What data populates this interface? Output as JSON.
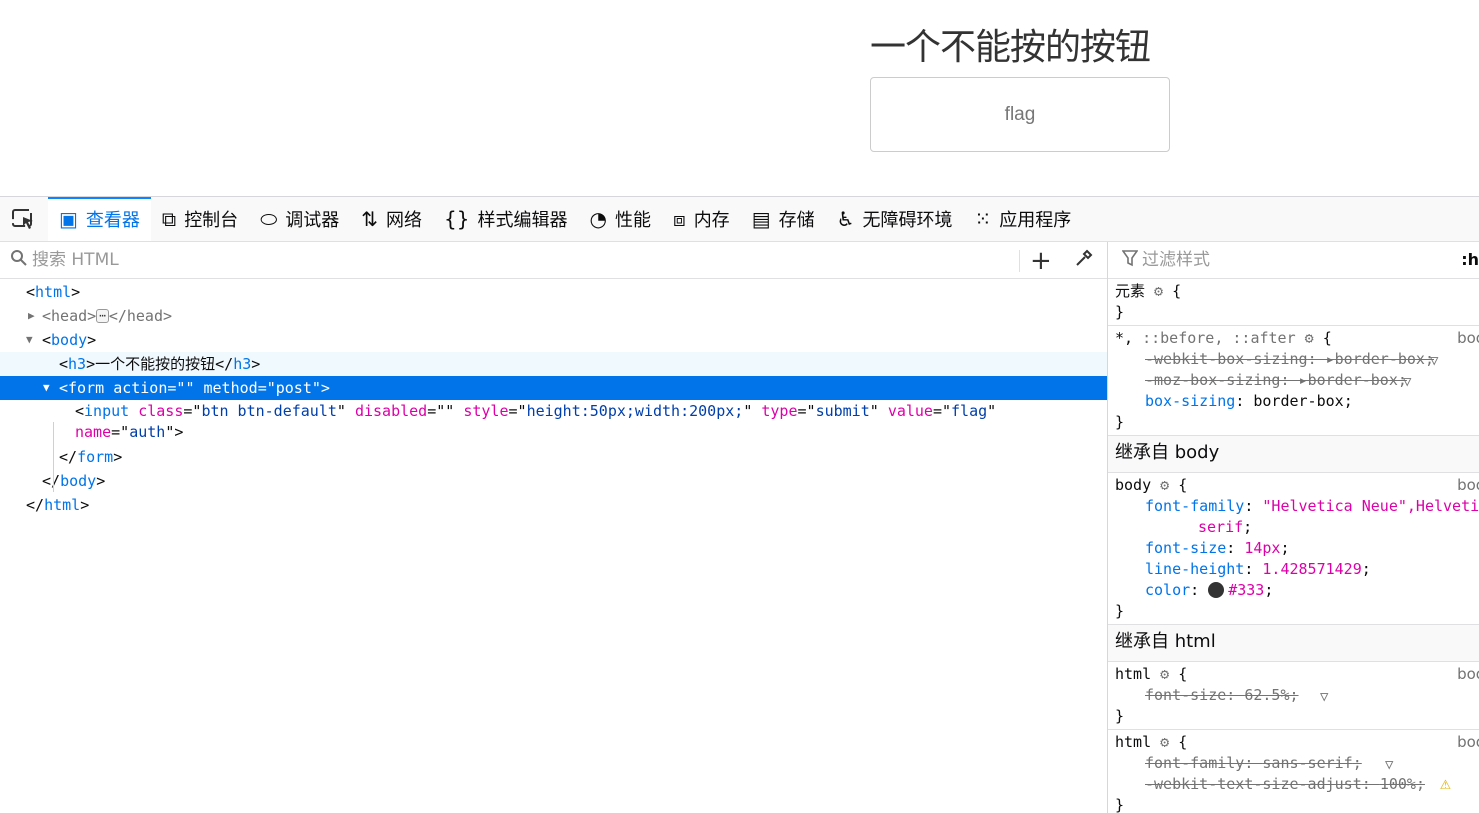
{
  "page": {
    "heading": "一个不能按的按钮",
    "button_value": "flag"
  },
  "devtools": {
    "tabs": [
      {
        "label": "查看器",
        "icon": "inspector-icon",
        "glyph": "▣",
        "active": true
      },
      {
        "label": "控制台",
        "icon": "console-icon",
        "glyph": "⧉",
        "active": false
      },
      {
        "label": "调试器",
        "icon": "debugger-icon",
        "glyph": "⬭",
        "active": false
      },
      {
        "label": "网络",
        "icon": "network-icon",
        "glyph": "⇅",
        "active": false
      },
      {
        "label": "样式编辑器",
        "icon": "style-editor-icon",
        "glyph": "{}",
        "active": false
      },
      {
        "label": "性能",
        "icon": "performance-icon",
        "glyph": "◔",
        "active": false
      },
      {
        "label": "内存",
        "icon": "memory-icon",
        "glyph": "⧈",
        "active": false
      },
      {
        "label": "存储",
        "icon": "storage-icon",
        "glyph": "▤",
        "active": false
      },
      {
        "label": "无障碍环境",
        "icon": "accessibility-icon",
        "glyph": "♿",
        "active": false
      },
      {
        "label": "应用程序",
        "icon": "application-icon",
        "glyph": "⁙",
        "active": false
      }
    ],
    "search_placeholder": "搜索 HTML",
    "filter_placeholder": "过滤样式",
    "pseudo_toggle": ":h",
    "markup": {
      "html_open": "html",
      "head": "head",
      "body_open": "body",
      "h3_tag": "h3",
      "h3_text": "一个不能按的按钮",
      "form_tag": "form",
      "form_action_attr": "action",
      "form_action_val": "",
      "form_method_attr": "method",
      "form_method_val": "post",
      "input_tag": "input",
      "input_class_attr": "class",
      "input_class_val": "btn btn-default",
      "input_disabled_attr": "disabled",
      "input_disabled_val": "",
      "input_style_attr": "style",
      "input_style_val": "height:50px;width:200px;",
      "input_type_attr": "type",
      "input_type_val": "submit",
      "input_value_attr": "value",
      "input_value_val": "flag",
      "input_name_attr": "name",
      "input_name_val": "auth"
    },
    "rules": {
      "element_selector": "元素",
      "universal_selector": "*, ::before, ::after",
      "source_short": "boo",
      "webkit_box_sizing": "-webkit-box-sizing",
      "moz_box_sizing": "-moz-box-sizing",
      "box_sizing": "box-sizing",
      "border_box": "border-box",
      "inherited_body": "继承自 body",
      "body_selector": "body",
      "font_family": "font-family",
      "font_family_val": "\"Helvetica Neue\",Helveti",
      "font_family_val2": "serif",
      "font_size": "font-size",
      "font_size_val": "14px",
      "line_height": "line-height",
      "line_height_val": "1.428571429",
      "color": "color",
      "color_val": "#333",
      "inherited_html": "继承自 html",
      "html_selector": "html",
      "html_font_size_val": "62.5%",
      "html_font_family_val": "sans-serif",
      "text_size_adjust": "-webkit-text-size-adjust",
      "text_size_adjust_val": "100%"
    }
  }
}
